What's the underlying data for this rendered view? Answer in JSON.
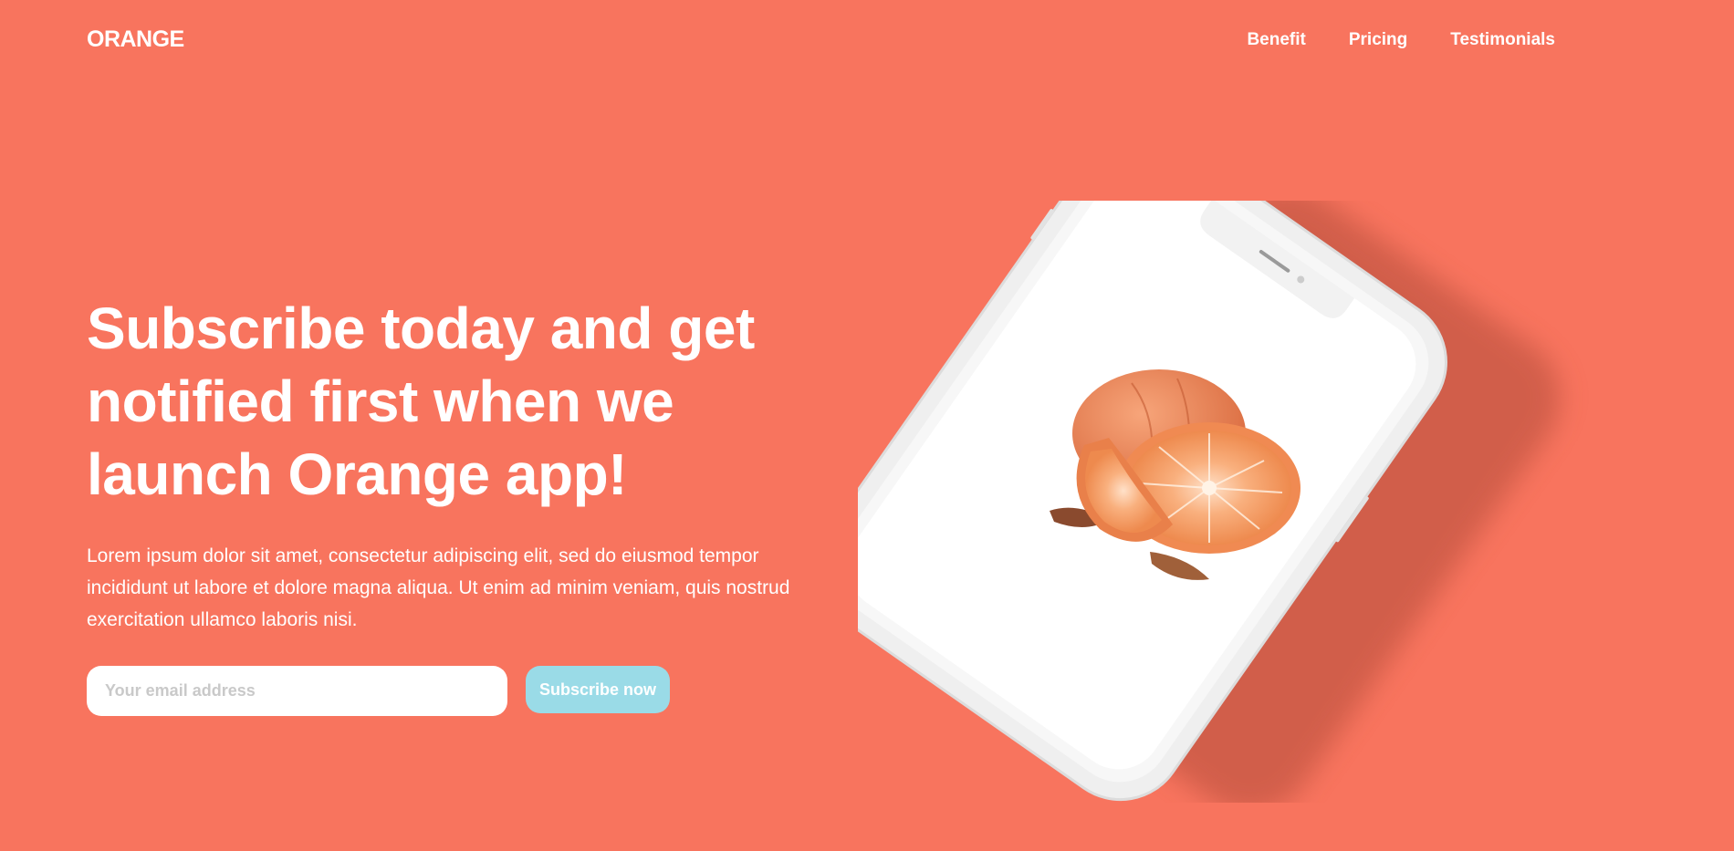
{
  "brand": {
    "logo_text": "ORANGE"
  },
  "nav": {
    "items": [
      {
        "label": "Benefit"
      },
      {
        "label": "Pricing"
      },
      {
        "label": "Testimonials"
      }
    ]
  },
  "hero": {
    "title": "Subscribe today and get notified first when we launch Orange app!",
    "description": "Lorem ipsum dolor sit amet, consectetur adipiscing elit, sed do eiusmod tempor incididunt ut labore et dolore magna aliqua. Ut enim ad minim veniam, quis nostrud exercitation ullamco laboris nisi."
  },
  "subscribe": {
    "email_placeholder": "Your email address",
    "email_value": "",
    "button_label": "Subscribe now"
  },
  "colors": {
    "background": "#F8745E",
    "button": "#9ADBE7",
    "text": "#FFFFFF"
  },
  "illustration": {
    "subject": "smartphone-with-orange-fruit"
  }
}
